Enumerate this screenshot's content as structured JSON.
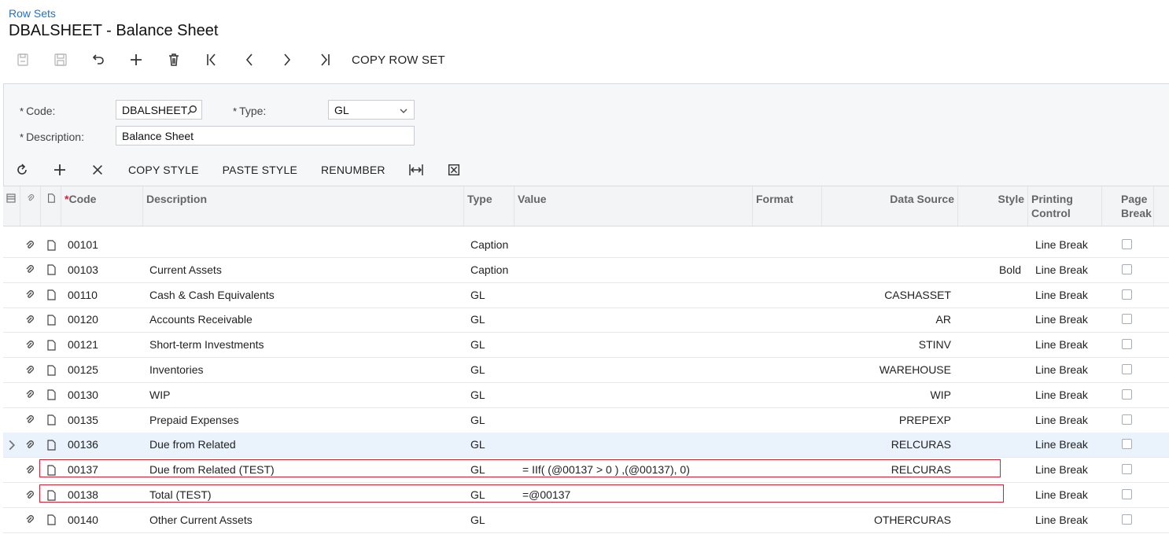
{
  "breadcrumb": "Row Sets",
  "page_title": "DBALSHEET - Balance Sheet",
  "toolbar": {
    "copy_row_set": "COPY ROW SET"
  },
  "form": {
    "code_label": "Code:",
    "code_value": "DBALSHEET",
    "type_label": "Type:",
    "type_value": "GL",
    "description_label": "Description:",
    "description_value": "Balance Sheet",
    "required_mark": "*"
  },
  "grid_toolbar": {
    "copy_style": "COPY STYLE",
    "paste_style": "PASTE STYLE",
    "renumber": "RENUMBER"
  },
  "grid": {
    "headers": {
      "code": "Code",
      "description": "Description",
      "type": "Type",
      "value": "Value",
      "format": "Format",
      "data_source": "Data Source",
      "style": "Style",
      "printing_control_1": "Printing",
      "printing_control_2": "Control",
      "page_break_1": "Page",
      "page_break_2": "Break"
    },
    "rows": [
      {
        "code": "00101",
        "description": "",
        "type": "Caption",
        "value": "",
        "data_source": "",
        "style": "",
        "printing": "Line Break"
      },
      {
        "code": "00103",
        "description": "Current Assets",
        "type": "Caption",
        "value": "",
        "data_source": "",
        "style": "Bold",
        "printing": "Line Break"
      },
      {
        "code": "00110",
        "description": "Cash & Cash Equivalents",
        "type": "GL",
        "value": "",
        "data_source": "CASHASSET",
        "style": "",
        "printing": "Line Break"
      },
      {
        "code": "00120",
        "description": "Accounts Receivable",
        "type": "GL",
        "value": "",
        "data_source": "AR",
        "style": "",
        "printing": "Line Break"
      },
      {
        "code": "00121",
        "description": "Short-term Investments",
        "type": "GL",
        "value": "",
        "data_source": "STINV",
        "style": "",
        "printing": "Line Break"
      },
      {
        "code": "00125",
        "description": "Inventories",
        "type": "GL",
        "value": "",
        "data_source": "WAREHOUSE",
        "style": "",
        "printing": "Line Break"
      },
      {
        "code": "00130",
        "description": "WIP",
        "type": "GL",
        "value": "",
        "data_source": "WIP",
        "style": "",
        "printing": "Line Break"
      },
      {
        "code": "00135",
        "description": "Prepaid Expenses",
        "type": "GL",
        "value": "",
        "data_source": "PREPEXP",
        "style": "",
        "printing": "Line Break"
      },
      {
        "code": "00136",
        "description": "Due from Related",
        "type": "GL",
        "value": "",
        "data_source": "RELCURAS",
        "style": "",
        "printing": "Line Break"
      },
      {
        "code": "00137",
        "description": "Due from Related (TEST)",
        "type": "GL",
        "value": "= IIf( (@00137 > 0 ) ,(@00137), 0)",
        "data_source": "RELCURAS",
        "style": "",
        "printing": "Line Break"
      },
      {
        "code": "00138",
        "description": "Total (TEST)",
        "type": "GL",
        "value": "=@00137",
        "data_source": "",
        "style": "",
        "printing": "Line Break"
      },
      {
        "code": "00140",
        "description": "Other Current Assets",
        "type": "GL",
        "value": "",
        "data_source": "OTHERCURAS",
        "style": "",
        "printing": "Line Break"
      }
    ]
  },
  "colors": {
    "accent": "#1c74c7",
    "highlight": "#c5283d",
    "selected_row": "#eaf2fb"
  }
}
